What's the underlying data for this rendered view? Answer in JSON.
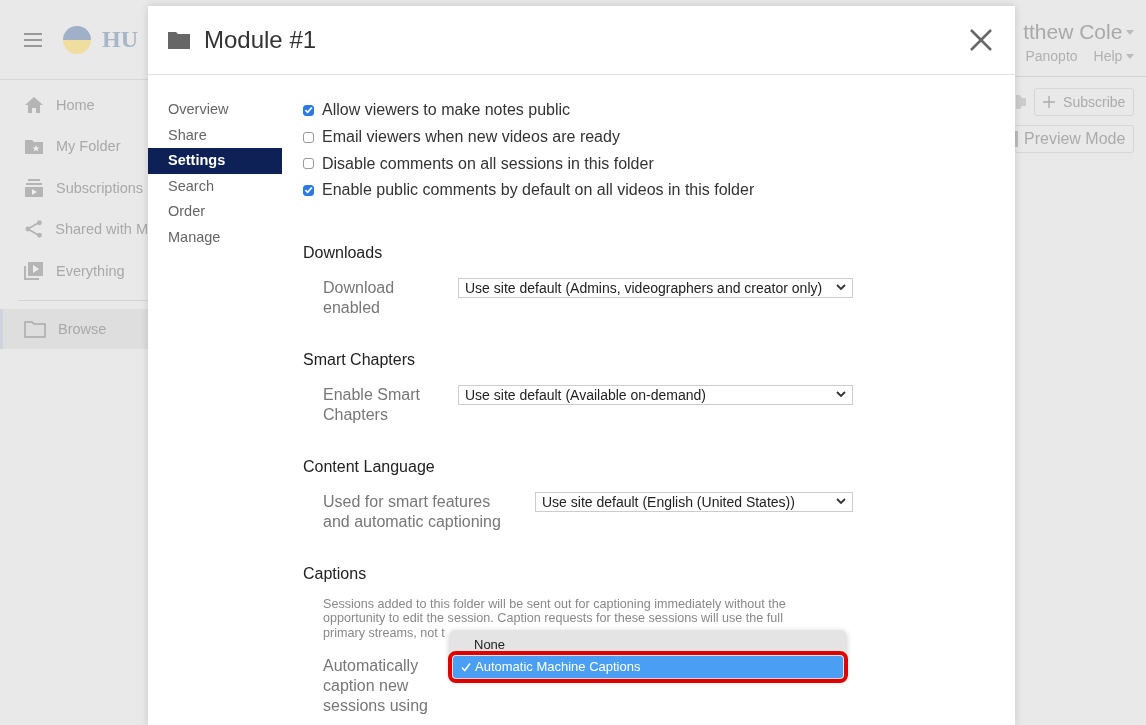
{
  "background_app": {
    "logo_text": "HU",
    "user_name": "tthew Cole",
    "header_links": [
      "Panopto",
      "Help"
    ],
    "sidebar": [
      {
        "label": "Home",
        "selected": false
      },
      {
        "label": "My Folder",
        "selected": false
      },
      {
        "label": "Subscriptions",
        "selected": false
      },
      {
        "label": "Shared with M",
        "selected": false
      },
      {
        "label": "Everything",
        "selected": false
      },
      {
        "label": "Browse",
        "selected": true
      }
    ],
    "buttons": [
      {
        "label": "Subscribe",
        "kind": "plus"
      },
      {
        "label": "Preview Mode",
        "kind": "clipped"
      }
    ]
  },
  "dialog": {
    "title": "Module #1",
    "nav": [
      {
        "label": "Overview",
        "selected": false
      },
      {
        "label": "Share",
        "selected": false
      },
      {
        "label": "Settings",
        "selected": true
      },
      {
        "label": "Search",
        "selected": false
      },
      {
        "label": "Order",
        "selected": false
      },
      {
        "label": "Manage",
        "selected": false
      }
    ],
    "checkboxes": [
      {
        "label": "Allow viewers to make notes public",
        "checked": true
      },
      {
        "label": "Email viewers when new videos are ready",
        "checked": false
      },
      {
        "label": "Disable comments on all sessions in this folder",
        "checked": false
      },
      {
        "label": "Enable public comments by default on all videos in this folder",
        "checked": true
      }
    ],
    "sections": [
      {
        "heading": "Downloads",
        "label": "Download enabled",
        "value": "Use site default (Admins, videographers and creator only)"
      },
      {
        "heading": "Smart Chapters",
        "label": "Enable Smart Chapters",
        "value": "Use site default (Available on-demand)"
      },
      {
        "heading": "Content Language",
        "label": "Used for smart features and automatic captioning",
        "value": "Use site default (English (United States))"
      }
    ],
    "captions": {
      "heading": "Captions",
      "description": "Sessions added to this folder will be sent out for captioning immediately without the opportunity to edit the session. Caption requests for these sessions will use the full primary streams, not t",
      "label": "Automatically caption new sessions using",
      "options": [
        {
          "label": "None",
          "selected": false
        },
        {
          "label": "Automatic Machine Captions",
          "selected": true
        }
      ]
    }
  }
}
